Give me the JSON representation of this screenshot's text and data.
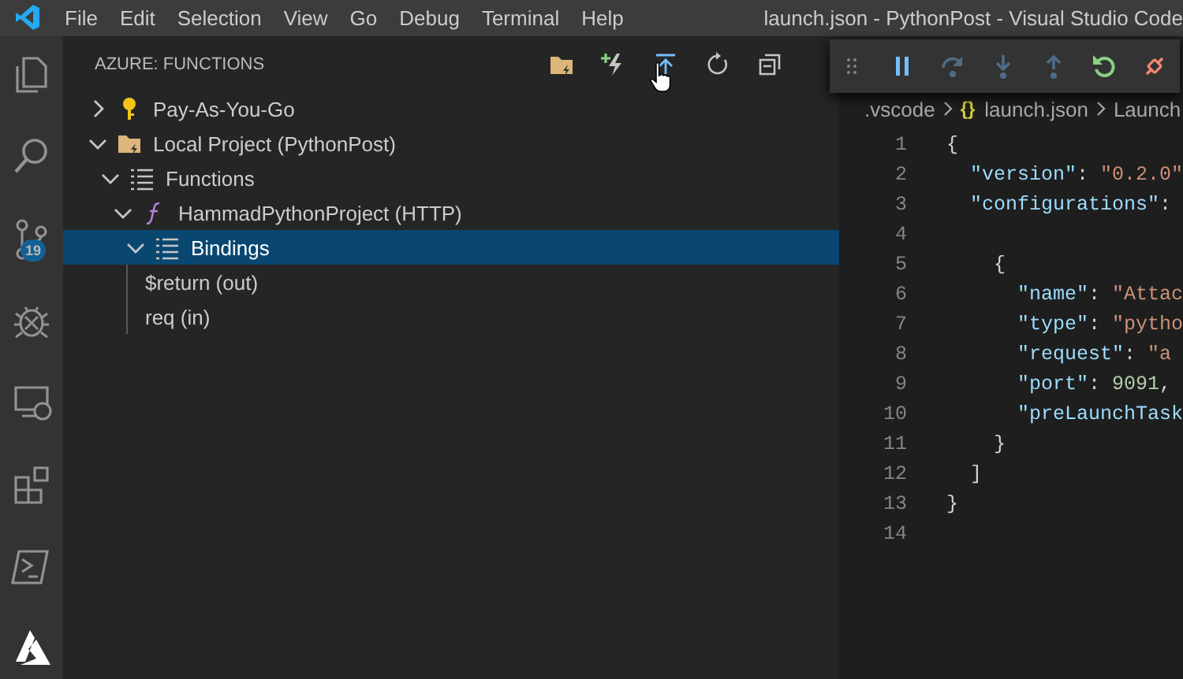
{
  "window": {
    "title": "launch.json - PythonPost - Visual Studio Code"
  },
  "menu": [
    "File",
    "Edit",
    "Selection",
    "View",
    "Go",
    "Debug",
    "Terminal",
    "Help"
  ],
  "activity_bar": [
    {
      "kind": "explorer",
      "selected": false
    },
    {
      "kind": "search",
      "selected": false
    },
    {
      "kind": "source-control",
      "selected": false,
      "badge": "19"
    },
    {
      "kind": "debug",
      "selected": false
    },
    {
      "kind": "remote",
      "selected": false
    },
    {
      "kind": "extensions",
      "selected": false
    },
    {
      "kind": "terminal",
      "selected": false
    },
    {
      "kind": "azure",
      "selected": true
    }
  ],
  "sidebar": {
    "title": "AZURE: FUNCTIONS",
    "actions": [
      {
        "kind": "folder-bolt"
      },
      {
        "kind": "bolt-plus"
      },
      {
        "kind": "upload"
      },
      {
        "kind": "refresh"
      },
      {
        "kind": "collapse"
      }
    ],
    "tree": [
      {
        "label": "Pay-As-You-Go",
        "kind": "key",
        "expanded": false,
        "selected": false
      },
      {
        "label": "Local Project (PythonPost)",
        "kind": "folder",
        "expanded": true,
        "selected": false,
        "children": [
          {
            "label": "Functions",
            "kind": "list",
            "expanded": true,
            "selected": false,
            "children": [
              {
                "label": "HammadPythonProject (HTTP)",
                "kind": "function",
                "expanded": true,
                "selected": false,
                "children": [
                  {
                    "label": "Bindings",
                    "kind": "list",
                    "expanded": true,
                    "selected": true,
                    "children": [
                      {
                        "label": "$return (out)",
                        "selected": false
                      },
                      {
                        "label": "req (in)",
                        "selected": false
                      }
                    ]
                  }
                ]
              }
            ]
          }
        ]
      }
    ]
  },
  "debug_toolbar": [
    {
      "kind": "grip",
      "disabled": false
    },
    {
      "kind": "pause",
      "disabled": false
    },
    {
      "kind": "step-over",
      "disabled": true
    },
    {
      "kind": "step-into",
      "disabled": true
    },
    {
      "kind": "step-out",
      "disabled": true
    },
    {
      "kind": "restart",
      "disabled": false
    },
    {
      "kind": "disconnect",
      "disabled": false
    }
  ],
  "editor": {
    "breadcrumbs": [
      {
        "label": ".vscode"
      },
      {
        "label": "launch.json",
        "icon": "{}"
      },
      {
        "label": "Launch"
      }
    ],
    "lines": [
      {
        "number": "1",
        "tokens": [
          {
            "kind": "punct",
            "text": "{"
          }
        ]
      },
      {
        "number": "2",
        "tokens": [
          {
            "kind": "key",
            "text": "  \"version\""
          },
          {
            "kind": "punct",
            "text": ": "
          },
          {
            "kind": "string",
            "text": "\"0.2.0\""
          }
        ]
      },
      {
        "number": "3",
        "tokens": [
          {
            "kind": "key",
            "text": "  \"configurations\""
          },
          {
            "kind": "punct",
            "text": ":"
          }
        ]
      },
      {
        "number": "4"
      },
      {
        "number": "5",
        "tokens": [
          {
            "kind": "punct",
            "text": "    {"
          }
        ]
      },
      {
        "number": "6",
        "tokens": [
          {
            "kind": "key",
            "text": "      \"name\""
          },
          {
            "kind": "punct",
            "text": ": "
          },
          {
            "kind": "string",
            "text": "\"Attac"
          }
        ]
      },
      {
        "number": "7",
        "tokens": [
          {
            "kind": "key",
            "text": "      \"type\""
          },
          {
            "kind": "punct",
            "text": ": "
          },
          {
            "kind": "string",
            "text": "\"pytho"
          }
        ]
      },
      {
        "number": "8",
        "tokens": [
          {
            "kind": "key",
            "text": "      \"request\""
          },
          {
            "kind": "punct",
            "text": ": "
          },
          {
            "kind": "string",
            "text": "\"a"
          }
        ]
      },
      {
        "number": "9",
        "tokens": [
          {
            "kind": "key",
            "text": "      \"port\""
          },
          {
            "kind": "punct",
            "text": ": "
          },
          {
            "kind": "number",
            "text": "9091"
          },
          {
            "kind": "punct",
            "text": ","
          }
        ]
      },
      {
        "number": "10",
        "tokens": [
          {
            "kind": "key",
            "text": "      \"preLaunchTask"
          }
        ]
      },
      {
        "number": "11",
        "tokens": [
          {
            "kind": "punct",
            "text": "    }"
          }
        ]
      },
      {
        "number": "12",
        "tokens": [
          {
            "kind": "punct",
            "text": "  ]"
          }
        ]
      },
      {
        "number": "13",
        "tokens": [
          {
            "kind": "punct",
            "text": "}"
          }
        ]
      },
      {
        "number": "14"
      }
    ]
  }
}
